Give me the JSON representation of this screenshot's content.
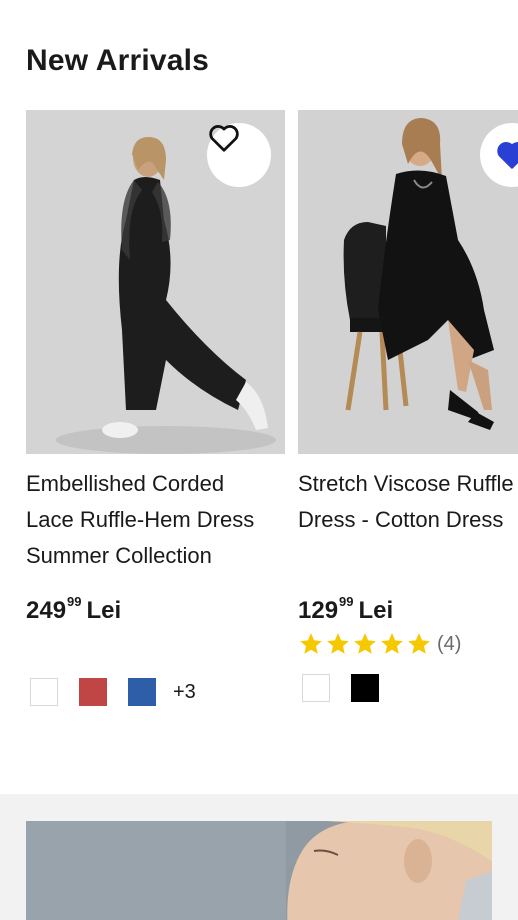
{
  "section": {
    "title": "New Arrivals"
  },
  "products": [
    {
      "name_line1": "Embellished Corded",
      "name_line2": "Lace Ruffle-Hem Dress",
      "name_line3": "Summer Collection",
      "price_main": "249",
      "price_cents": "99",
      "currency": "Lei",
      "wishlisted": false,
      "rating": null,
      "rating_count": "",
      "swatches": [
        "#ffffff",
        "#c04545",
        "#2f5ea8"
      ],
      "more_swatches": "+3"
    },
    {
      "name_line1": "Stretch Viscose Ruffle",
      "name_line2": "Dress - Cotton Dress",
      "name_line3": "",
      "price_main": "129",
      "price_cents": "99",
      "currency": "Lei",
      "wishlisted": true,
      "rating": 5,
      "rating_count": "(4)",
      "swatches": [
        "#ffffff",
        "#000000"
      ],
      "more_swatches": ""
    }
  ],
  "colors": {
    "star": "#f5c800",
    "wishlist_active": "#2a3fd4",
    "promo_bg": "#f2f2f2"
  },
  "icons": {
    "wishlist": "heart-icon",
    "rating": "star-icon"
  }
}
